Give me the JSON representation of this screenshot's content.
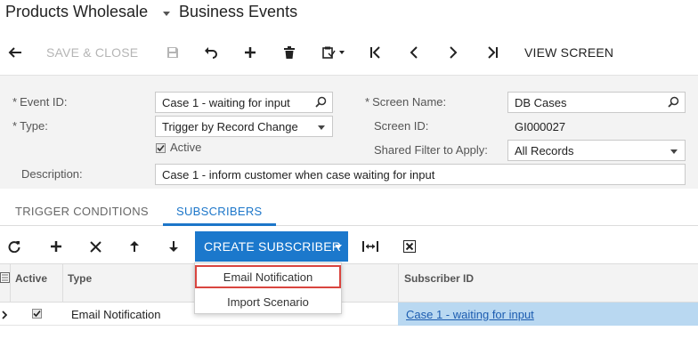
{
  "header": {
    "company": "Products Wholesale",
    "screen_title": "Business Events"
  },
  "toolbar": {
    "save_close_label": "SAVE & CLOSE",
    "view_screen_label": "VIEW SCREEN",
    "icons": [
      "back-icon",
      "save-icon",
      "undo-icon",
      "add-icon",
      "delete-icon",
      "clipboard-icon",
      "first-icon",
      "previous-icon",
      "next-icon",
      "last-icon"
    ]
  },
  "form": {
    "event_id_label": "Event ID:",
    "event_id_value": "Case 1 - waiting for input",
    "type_label": "Type:",
    "type_value": "Trigger by Record Change",
    "active_label": "Active",
    "active_checked": true,
    "description_label": "Description:",
    "description_value": "Case 1 - inform customer when case waiting for input",
    "screen_name_label": "Screen Name:",
    "screen_name_value": "DB Cases",
    "screen_id_label": "Screen ID:",
    "screen_id_value": "GI000027",
    "shared_filter_label": "Shared Filter to Apply:",
    "shared_filter_value": "All Records",
    "required_marker": "*"
  },
  "tabs": [
    {
      "label": "TRIGGER CONDITIONS",
      "active": false
    },
    {
      "label": "SUBSCRIBERS",
      "active": true
    }
  ],
  "grid_toolbar": {
    "create_subscriber_label": "CREATE SUBSCRIBER",
    "icons": [
      "refresh-icon",
      "add-row-icon",
      "delete-row-icon",
      "move-up-icon",
      "move-down-icon",
      "fit-columns-icon",
      "export-excel-icon"
    ]
  },
  "grid": {
    "columns": [
      "Active",
      "Type",
      "Subscriber ID"
    ],
    "rows": [
      {
        "active": true,
        "type": "Email Notification",
        "subscriber_id": "Case 1 - waiting for input"
      }
    ]
  },
  "dropdown": {
    "items": [
      "Email Notification",
      "Import Scenario"
    ],
    "highlighted": "Email Notification"
  },
  "colors": {
    "accent": "#1b78cc",
    "highlight_border": "#d9453f",
    "selected_cell": "#b9d8f1"
  }
}
